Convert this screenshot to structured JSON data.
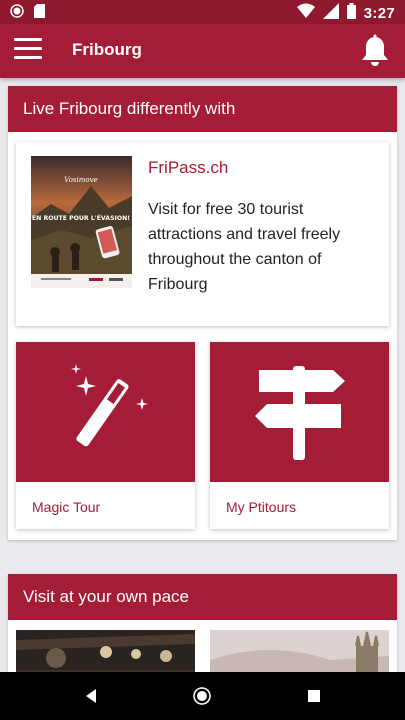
{
  "status_bar": {
    "time": "3:27",
    "icons": [
      "circle-notification-icon",
      "sd-card-icon",
      "wifi-icon",
      "cell-signal-icon",
      "battery-icon"
    ]
  },
  "app_bar": {
    "title": "Fribourg",
    "menu_icon": "hamburger-menu-icon",
    "bell_icon": "bell-icon"
  },
  "section_live": {
    "header": "Live Fribourg differently with",
    "fripass": {
      "poster_headline": "EN ROUTE POUR L'ÉVASION!",
      "title": "FriPass.ch",
      "description": "Visit for free 30 tourist attractions and travel freely throughout the canton of Fribourg"
    },
    "tiles": [
      {
        "label": "Magic Tour",
        "icon": "magic-wand-icon"
      },
      {
        "label": "My Ptitours",
        "icon": "signpost-icon"
      }
    ]
  },
  "section_visit": {
    "header": "Visit at your own pace"
  },
  "nav_bar": {
    "icons": [
      "back-icon",
      "home-icon",
      "recents-icon"
    ]
  },
  "colors": {
    "primary": "#a51c36",
    "status_bar": "#8f1a30",
    "background": "#e9e9ee"
  }
}
